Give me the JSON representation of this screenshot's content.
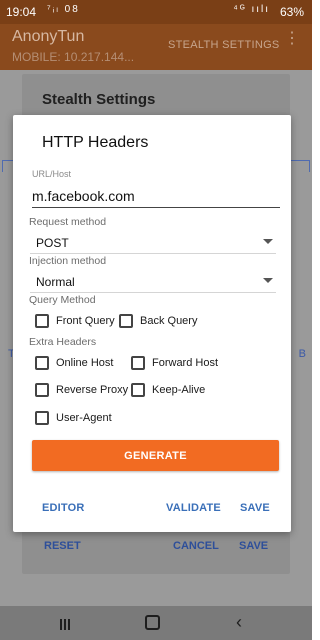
{
  "status_bar": {
    "time": "19:04",
    "left_icons": "⁷ᵢₗ 08",
    "right_icons": "⁴ᴳ ıılı",
    "battery": "63%"
  },
  "app_bar": {
    "title": "AnonyTun",
    "subtitle": "MOBILE: 10.217.144...",
    "action_label": "STEALTH SETTINGS",
    "more_icon": "⋮"
  },
  "background_edges": {
    "left_text": "TX",
    "right_text": "B"
  },
  "stealth_dialog": {
    "title": "Stealth Settings",
    "reset_label": "RESET",
    "cancel_label": "CANCEL",
    "save_label": "SAVE"
  },
  "http_headers_dialog": {
    "title": "HTTP Headers",
    "host_field": {
      "label": "URL/Host",
      "value": "m.facebook.com"
    },
    "request_method": {
      "label": "Request method",
      "selected": "POST"
    },
    "injection_method": {
      "label": "Injection method",
      "selected": "Normal"
    },
    "query_method": {
      "label": "Query Method",
      "options": [
        "Front Query",
        "Back Query"
      ]
    },
    "extra_headers": {
      "label": "Extra Headers",
      "options": [
        "Online Host",
        "Forward Host",
        "Reverse Proxy",
        "Keep-Alive",
        "User-Agent"
      ]
    },
    "generate_label": "GENERATE",
    "editor_label": "EDITOR",
    "validate_label": "VALIDATE",
    "save_label": "SAVE"
  },
  "colors": {
    "accent_orange": "#f26b22",
    "app_bar": "#8a4a1d",
    "link_blue": "#3a6fb8"
  }
}
